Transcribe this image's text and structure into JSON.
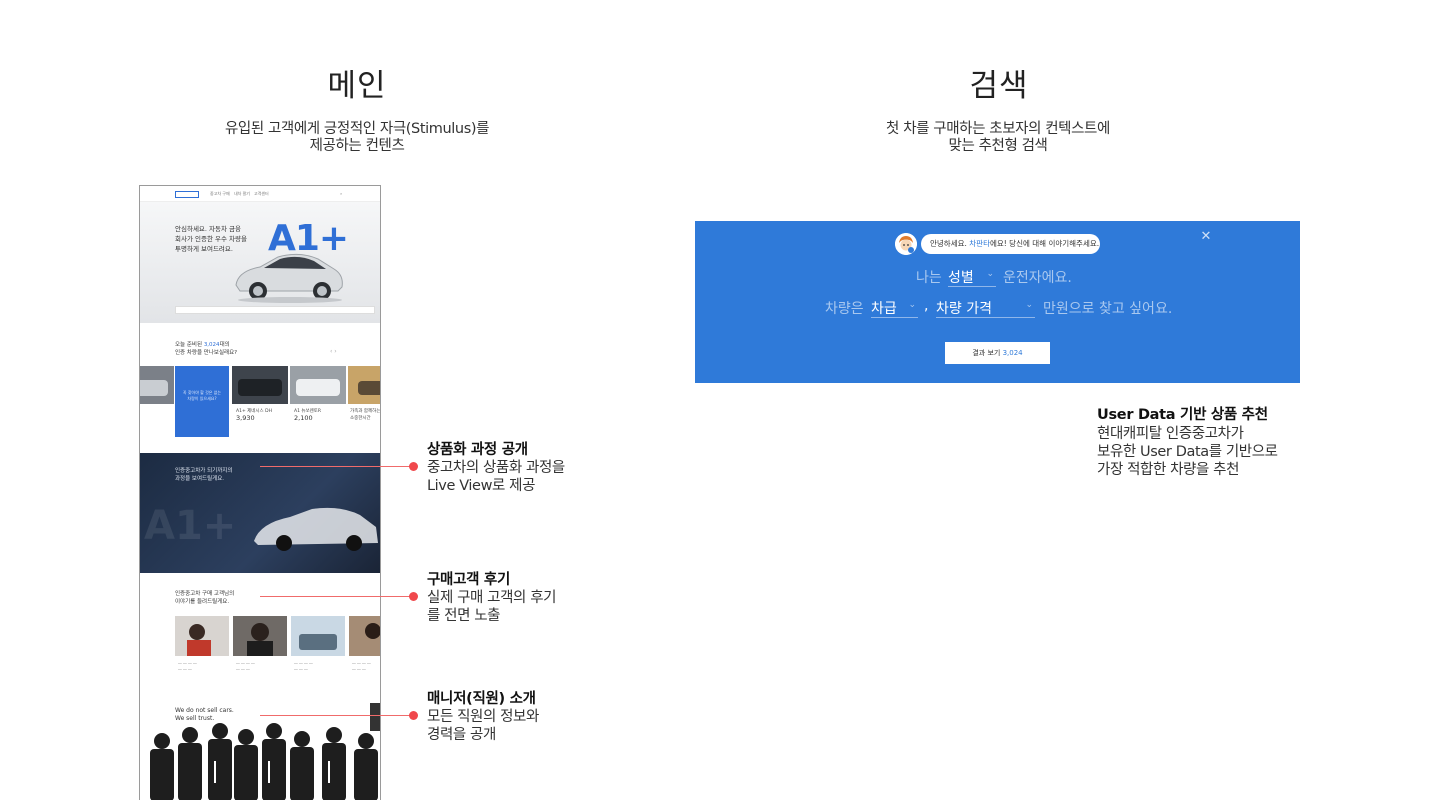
{
  "main_column": {
    "title": "메인",
    "subtitle_line1": "유입된 고객에게 긍정적인 자극(Stimulus)를",
    "subtitle_line2": "제공하는 컨텐츠"
  },
  "search_column": {
    "title": "검색",
    "subtitle_line1": "첫 차를 구매하는 초보자의 컨텍스트에",
    "subtitle_line2": "맞는 추천형 검색"
  },
  "mockup": {
    "nav_items": [
      "중고차 구매",
      "내차 팔기",
      "고객센터"
    ],
    "hero_text": [
      "안심하세요. 자동차 금융",
      "회사가 인증한 우수 차량을",
      "투명하게 보여드려요."
    ],
    "hero_brand": "A1+",
    "section2_text_a": "오늘 준비된 ",
    "section2_count": "3,024",
    "section2_text_b": "대의",
    "section2_line2": "인증 차량을 만나보실래요?",
    "blue_card_text": "꼭 찾아야 할 것은 없는 차량이 있으세요?",
    "products": [
      {
        "name": "A1+ 제네시스 DH",
        "price": "3,930"
      },
      {
        "name": "A1 뉴쏘렌토R",
        "price": "2,100"
      },
      {
        "name": "가족과 함께하는 소중한시간",
        "price": ""
      }
    ],
    "dark_text": [
      "인증중고차가 되기까지의",
      "과정을 보여드릴게요."
    ],
    "dark_brand": "A1+",
    "review_text": [
      "인증중고차 구매 고객님의",
      "이야기를 들려드릴게요."
    ],
    "manager_text": [
      "We do not sell cars.",
      "We sell trust."
    ]
  },
  "annotations": [
    {
      "title": "상품화 과정 공개",
      "desc_line1": "중고차의 상품화 과정을",
      "desc_line2": "Live View로 제공"
    },
    {
      "title": "구매고객 후기",
      "desc_line1": "실제 구매 고객의 후기",
      "desc_line2": "를 전면 노출"
    },
    {
      "title": "매니저(직원) 소개",
      "desc_line1": "모든 직원의 정보와",
      "desc_line2": "경력을 공개"
    }
  ],
  "search_panel": {
    "bubble_prefix": "안녕하세요. ",
    "bubble_name": "차판타",
    "bubble_suffix": "에요! 당신에 대해 이야기해주세요.",
    "row1_prefix": "나는",
    "gender_select": "성별",
    "row1_suffix": "운전자에요.",
    "row2_prefix": "차량은",
    "budget_select": "차급",
    "comma": ",",
    "price_select": "차량 가격",
    "row2_suffix": "만원으로 찾고 싶어요.",
    "result_label": "결과 보기",
    "result_count": "3,024"
  },
  "recommendation": {
    "title": "User Data 기반 상품 추천",
    "desc_line1": "현대캐피탈 인증중고차가",
    "desc_line2": "보유한 User Data를 기반으로",
    "desc_line3": "가장 적합한 차량을 추천"
  },
  "colors": {
    "accent_blue": "#2f7ad9",
    "annotation_red": "#f0484c"
  }
}
